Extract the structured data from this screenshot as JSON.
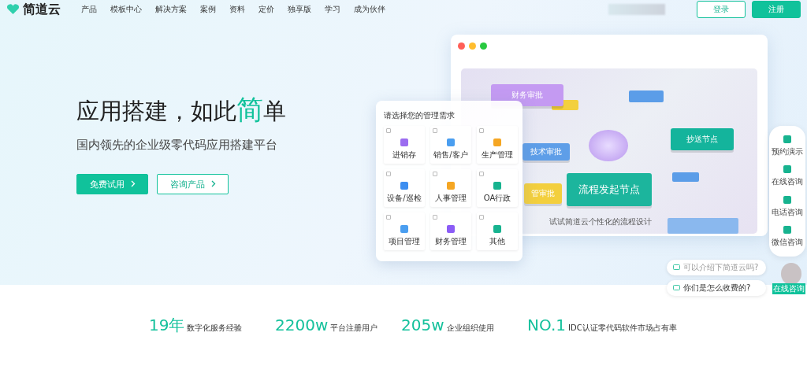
{
  "nav": {
    "logo": "简道云",
    "items": [
      "产品",
      "模板中心",
      "解决方案",
      "案例",
      "资料",
      "定价",
      "独享版",
      "学习",
      "成为伙伴"
    ],
    "login": "登录",
    "register": "注册"
  },
  "hero": {
    "title_before": "应用搭建，如此",
    "title_highlight": "简",
    "title_after": "单",
    "subtitle": "国内领先的企业级零代码应用搭建平台",
    "buttons": [
      {
        "label": "免费试用",
        "kind": "primary"
      },
      {
        "label": "咨询产品",
        "kind": "outline"
      }
    ]
  },
  "flow": {
    "nodes": [
      {
        "kind": "purple",
        "label": "财务审批"
      },
      {
        "kind": "blue",
        "label": "技术审批"
      },
      {
        "kind": "yellow",
        "label": "管审批"
      },
      {
        "kind": "main",
        "label": "流程发起节点"
      },
      {
        "kind": "teal",
        "label": "抄送节点"
      }
    ],
    "caption": "试试简道云个性化的流程设计"
  },
  "needs": {
    "title": "请选择您的管理需求",
    "options": [
      {
        "label": "进销存",
        "checked": false
      },
      {
        "label": "销售/客户",
        "checked": false
      },
      {
        "label": "生产管理",
        "checked": false
      },
      {
        "label": "设备/巡检",
        "checked": false
      },
      {
        "label": "人事管理",
        "checked": false
      },
      {
        "label": "OA行政",
        "checked": false
      },
      {
        "label": "项目管理",
        "checked": false
      },
      {
        "label": "财务管理",
        "checked": false
      },
      {
        "label": "其他",
        "checked": false
      }
    ]
  },
  "side_bar": [
    "预约演示",
    "在线咨询",
    "电话咨询",
    "微信咨询"
  ],
  "chat": {
    "questions": [
      "可以介绍下简道云吗?",
      "你们是怎么收费的?"
    ],
    "button": "在线咨询"
  },
  "stats": [
    {
      "value": "19",
      "unit": "年",
      "label": "数字化服务经验"
    },
    {
      "value": "2200",
      "unit": "w",
      "label": "平台注册用户"
    },
    {
      "value": "205",
      "unit": "w",
      "label": "企业组织使用"
    },
    {
      "value": "NO.1",
      "label": "IDC认证零代码软件市场占有率"
    }
  ]
}
